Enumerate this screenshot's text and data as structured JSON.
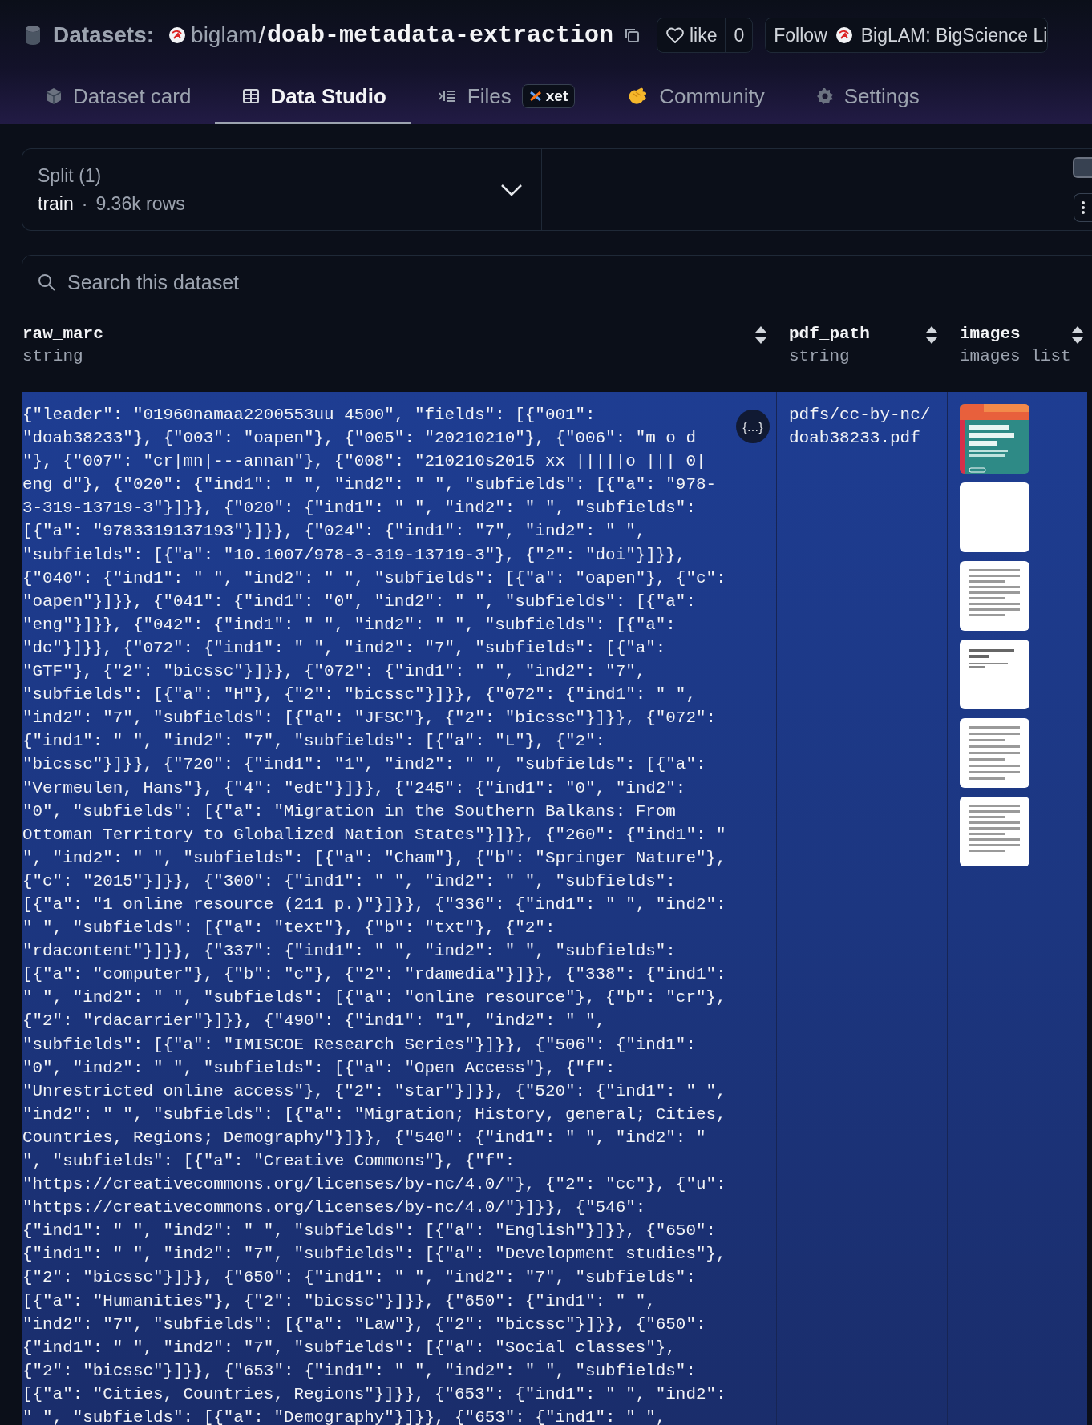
{
  "header": {
    "section": "Datasets:",
    "owner": "biglam",
    "separator": "/",
    "name": "doab-metadata-extraction",
    "like": {
      "label": "like",
      "count": "0"
    },
    "follow": {
      "label": "Follow",
      "org": "BigLAM: BigScience Li"
    }
  },
  "tabs": [
    {
      "label": "Dataset card",
      "selected": false
    },
    {
      "label": "Data Studio",
      "selected": true
    },
    {
      "label": "Files",
      "badge": "xet",
      "selected": false
    },
    {
      "label": "Community",
      "selected": false
    },
    {
      "label": "Settings",
      "selected": false
    }
  ],
  "split": {
    "label": "Split (1)",
    "name": "train",
    "separator": "·",
    "rows": "9.36k rows"
  },
  "search": {
    "placeholder": "Search this dataset"
  },
  "table": {
    "columns": [
      {
        "name": "raw_marc",
        "type": "string"
      },
      {
        "name": "pdf_path",
        "type": "string"
      },
      {
        "name": "images",
        "type": "images list"
      }
    ],
    "rows": [
      {
        "selected": true,
        "expand_button": "{…}",
        "raw_marc": "{\"leader\": \"01960namaa2200553uu 4500\", \"fields\": [{\"001\": \"doab38233\"}, {\"003\": \"oapen\"}, {\"005\": \"20210210\"}, {\"006\": \"m o d \"}, {\"007\": \"cr|mn|---annan\"}, {\"008\": \"210210s2015 xx |||||o ||| 0| eng d\"}, {\"020\": {\"ind1\": \" \", \"ind2\": \" \", \"subfields\": [{\"a\": \"978-3-319-13719-3\"}]}}, {\"020\": {\"ind1\": \" \", \"ind2\": \" \", \"subfields\": [{\"a\": \"9783319137193\"}]}}, {\"024\": {\"ind1\": \"7\", \"ind2\": \" \", \"subfields\": [{\"a\": \"10.1007/978-3-319-13719-3\"}, {\"2\": \"doi\"}]}}, {\"040\": {\"ind1\": \" \", \"ind2\": \" \", \"subfields\": [{\"a\": \"oapen\"}, {\"c\": \"oapen\"}]}}, {\"041\": {\"ind1\": \"0\", \"ind2\": \" \", \"subfields\": [{\"a\": \"eng\"}]}}, {\"042\": {\"ind1\": \" \", \"ind2\": \" \", \"subfields\": [{\"a\": \"dc\"}]}}, {\"072\": {\"ind1\": \" \", \"ind2\": \"7\", \"subfields\": [{\"a\": \"GTF\"}, {\"2\": \"bicssc\"}]}}, {\"072\": {\"ind1\": \" \", \"ind2\": \"7\", \"subfields\": [{\"a\": \"H\"}, {\"2\": \"bicssc\"}]}}, {\"072\": {\"ind1\": \" \", \"ind2\": \"7\", \"subfields\": [{\"a\": \"JFSC\"}, {\"2\": \"bicssc\"}]}}, {\"072\": {\"ind1\": \" \", \"ind2\": \"7\", \"subfields\": [{\"a\": \"L\"}, {\"2\": \"bicssc\"}]}}, {\"720\": {\"ind1\": \"1\", \"ind2\": \" \", \"subfields\": [{\"a\": \"Vermeulen, Hans\"}, {\"4\": \"edt\"}]}}, {\"245\": {\"ind1\": \"0\", \"ind2\": \"0\", \"subfields\": [{\"a\": \"Migration in the Southern Balkans: From Ottoman Territory to Globalized Nation States\"}]}}, {\"260\": {\"ind1\": \" \", \"ind2\": \" \", \"subfields\": [{\"a\": \"Cham\"}, {\"b\": \"Springer Nature\"}, {\"c\": \"2015\"}]}}, {\"300\": {\"ind1\": \" \", \"ind2\": \" \", \"subfields\": [{\"a\": \"1 online resource (211 p.)\"}]}}, {\"336\": {\"ind1\": \" \", \"ind2\": \" \", \"subfields\": [{\"a\": \"text\"}, {\"b\": \"txt\"}, {\"2\": \"rdacontent\"}]}}, {\"337\": {\"ind1\": \" \", \"ind2\": \" \", \"subfields\": [{\"a\": \"computer\"}, {\"b\": \"c\"}, {\"2\": \"rdamedia\"}]}}, {\"338\": {\"ind1\": \" \", \"ind2\": \" \", \"subfields\": [{\"a\": \"online resource\"}, {\"b\": \"cr\"}, {\"2\": \"rdacarrier\"}]}}, {\"490\": {\"ind1\": \"1\", \"ind2\": \" \", \"subfields\": [{\"a\": \"IMISCOE Research Series\"}]}}, {\"506\": {\"ind1\": \"0\", \"ind2\": \" \", \"subfields\": [{\"a\": \"Open Access\"}, {\"f\": \"Unrestricted online access\"}, {\"2\": \"star\"}]}}, {\"520\": {\"ind1\": \" \", \"ind2\": \" \", \"subfields\": [{\"a\": \"Migration; History, general; Cities, Countries, Regions; Demography\"}]}}, {\"540\": {\"ind1\": \" \", \"ind2\": \" \", \"subfields\": [{\"a\": \"Creative Commons\"}, {\"f\": \"https://creativecommons.org/licenses/by-nc/4.0/\"}, {\"2\": \"cc\"}, {\"u\": \"https://creativecommons.org/licenses/by-nc/4.0/\"}]}}, {\"546\": {\"ind1\": \" \", \"ind2\": \" \", \"subfields\": [{\"a\": \"English\"}]}}, {\"650\": {\"ind1\": \" \", \"ind2\": \"7\", \"subfields\": [{\"a\": \"Development studies\"}, {\"2\": \"bicssc\"}]}}, {\"650\": {\"ind1\": \" \", \"ind2\": \"7\", \"subfields\": [{\"a\": \"Humanities\"}, {\"2\": \"bicssc\"}]}}, {\"650\": {\"ind1\": \" \", \"ind2\": \"7\", \"subfields\": [{\"a\": \"Law\"}, {\"2\": \"bicssc\"}]}}, {\"650\": {\"ind1\": \" \", \"ind2\": \"7\", \"subfields\": [{\"a\": \"Social classes\"}, {\"2\": \"bicssc\"}]}}, {\"653\": {\"ind1\": \" \", \"ind2\": \" \", \"subfields\": [{\"a\": \"Cities, Countries, Regions\"}]}}, {\"653\": {\"ind1\": \" \", \"ind2\": \" \", \"subfields\": [{\"a\": \"Demography\"}]}}, {\"653\": {\"ind1\": \" \",",
        "pdf_path": "pdfs/cc-by-nc/doab38233.pdf"
      }
    ]
  }
}
